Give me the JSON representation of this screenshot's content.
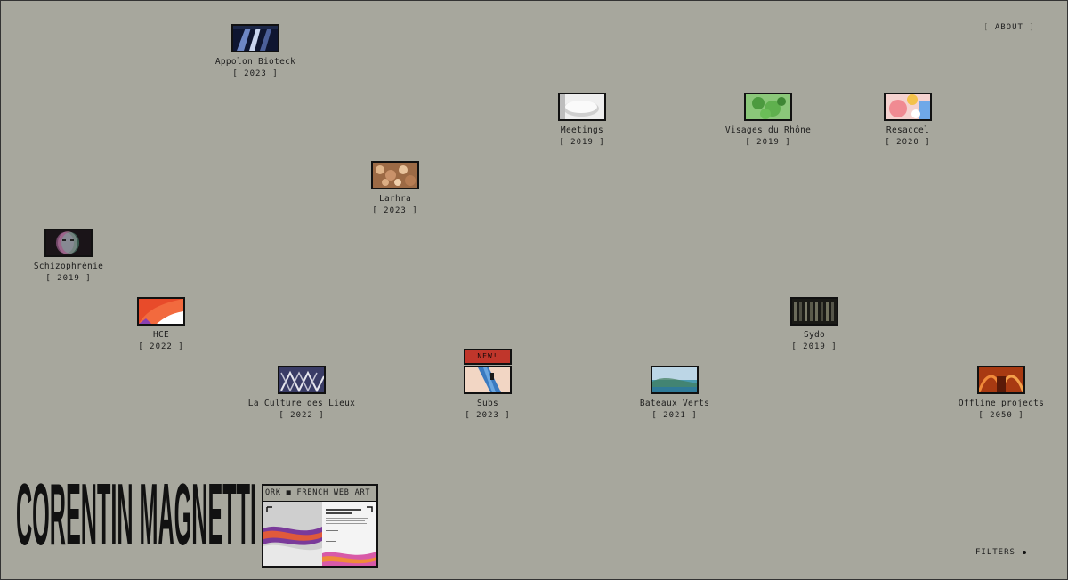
{
  "nav": {
    "about_label": "ABOUT",
    "bracket_open": "[",
    "bracket_close": "]"
  },
  "projects": [
    {
      "name": "Appolon Bioteck",
      "year": "[ 2023 ]",
      "thumb": "bioteck-thumbnail"
    },
    {
      "name": "Meetings",
      "year": "[ 2019 ]",
      "thumb": "meetings-thumbnail"
    },
    {
      "name": "Visages du Rhône",
      "year": "[ 2019 ]",
      "thumb": "visages-thumbnail"
    },
    {
      "name": "Resaccel",
      "year": "[ 2020 ]",
      "thumb": "resaccel-thumbnail"
    },
    {
      "name": "Larhra",
      "year": "[ 2023 ]",
      "thumb": "larhra-thumbnail"
    },
    {
      "name": "Schizophrénie",
      "year": "[ 2019 ]",
      "thumb": "schizo-thumbnail"
    },
    {
      "name": "HCE",
      "year": "[ 2022 ]",
      "thumb": "hce-thumbnail"
    },
    {
      "name": "Sydo",
      "year": "[ 2019 ]",
      "thumb": "sydo-thumbnail"
    },
    {
      "name": "La Culture des Lieux",
      "year": "[ 2022 ]",
      "thumb": "culture-thumbnail"
    },
    {
      "name": "Subs",
      "year": "[ 2023 ]",
      "badge": "NEW!",
      "thumb": "subs-thumbnail"
    },
    {
      "name": "Bateaux Verts",
      "year": "[ 2021 ]",
      "thumb": "bateaux-thumbnail"
    },
    {
      "name": "Offline projects",
      "year": "[ 2050 ]",
      "thumb": "offline-thumbnail"
    }
  ],
  "brand": {
    "name": "CORENTIN MAGNETTI"
  },
  "marquee": {
    "text": "ORK  ■  FRENCH WEB ART  ■"
  },
  "filters": {
    "label": "FILTERS"
  },
  "colors": {
    "background": "#a7a79d",
    "ink": "#111111",
    "badge": "#c0362b"
  }
}
